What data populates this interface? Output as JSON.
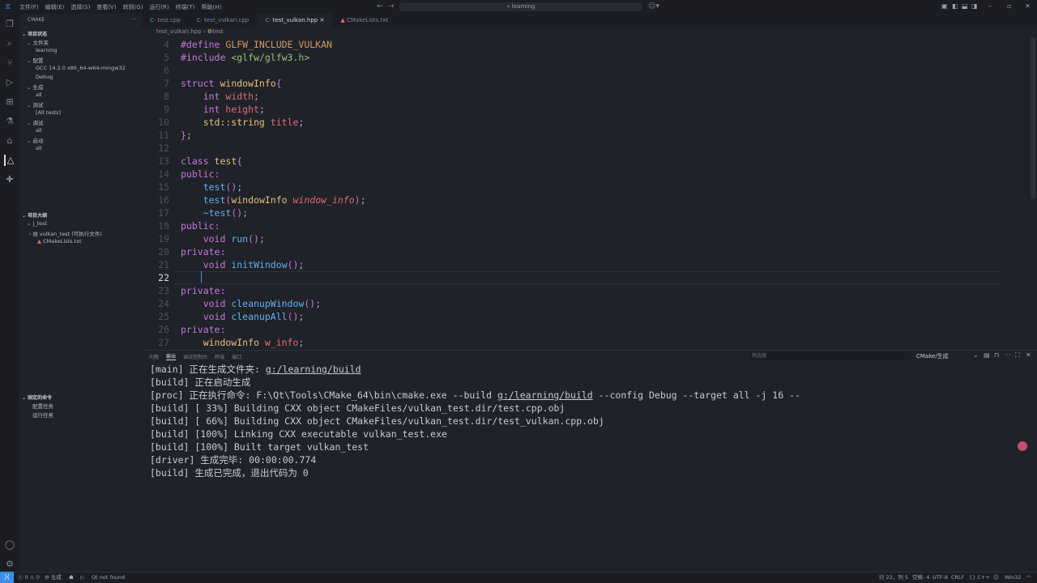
{
  "titlebar": {
    "menus": [
      "文件(F)",
      "编辑(E)",
      "选择(S)",
      "查看(V)",
      "转到(G)",
      "运行(R)",
      "终端(T)",
      "帮助(H)"
    ],
    "search": "learning"
  },
  "sidebar": {
    "title": "CMAKE",
    "project_status": "项目状态",
    "folder": "文件夹",
    "folder_value": "learning",
    "config": "配置",
    "config_kit": "GCC 14.2.0 x86_64-w64-mingw32",
    "config_type": "Debug",
    "build": "生成",
    "build_value": "all",
    "test": "测试",
    "test_value": "[All tests]",
    "debug": "调试",
    "debug_value": "all",
    "launch": "启动",
    "launch_value": "all",
    "outline": "项目大纲",
    "outline_root": "j_test",
    "outline_target": "vulkan_test (可执行文件)",
    "outline_file": "CMakeLists.txt",
    "pinned": "固定的命令",
    "pinned_items": [
      "配置任务",
      "运行任务"
    ]
  },
  "tabs": [
    {
      "label": "test.cpp"
    },
    {
      "label": "test_vulkan.cpp"
    },
    {
      "label": "test_vulkan.hpp",
      "active": true
    },
    {
      "label": "CMakeLists.txt"
    }
  ],
  "breadcrumb": [
    "test_vulkan.hpp",
    "test"
  ],
  "code": [
    {
      "n": "4",
      "t": [
        [
          "#define ",
          "kw"
        ],
        [
          "GLFW_INCLUDE_VULKAN",
          "df"
        ]
      ]
    },
    {
      "n": "5",
      "t": [
        [
          "#include ",
          "kw"
        ],
        [
          "<glfw/glfw3.h>",
          "st"
        ]
      ]
    },
    {
      "n": "6",
      "t": []
    },
    {
      "n": "7",
      "t": [
        [
          "struct ",
          "kw"
        ],
        [
          "windowInfo",
          "ty"
        ],
        [
          "{",
          "br"
        ]
      ]
    },
    {
      "n": "8",
      "t": [
        [
          "    int ",
          "kw"
        ],
        [
          "width",
          "va"
        ],
        [
          ";",
          ""
        ]
      ]
    },
    {
      "n": "9",
      "t": [
        [
          "    int ",
          "kw"
        ],
        [
          "height",
          "va"
        ],
        [
          ";",
          ""
        ]
      ]
    },
    {
      "n": "10",
      "t": [
        [
          "    std::string ",
          "ty"
        ],
        [
          "title",
          "va"
        ],
        [
          ";",
          ""
        ]
      ]
    },
    {
      "n": "11",
      "t": [
        [
          "}",
          "br"
        ],
        [
          ";",
          ""
        ]
      ]
    },
    {
      "n": "12",
      "t": []
    },
    {
      "n": "13",
      "t": [
        [
          "class ",
          "kw"
        ],
        [
          "test",
          "ty"
        ],
        [
          "{",
          "br"
        ]
      ]
    },
    {
      "n": "14",
      "t": [
        [
          "public:",
          "kw"
        ]
      ]
    },
    {
      "n": "15",
      "t": [
        [
          "    test",
          "fn"
        ],
        [
          "()",
          "br"
        ],
        [
          ";",
          ""
        ]
      ]
    },
    {
      "n": "16",
      "t": [
        [
          "    test",
          "fn"
        ],
        [
          "(",
          "br"
        ],
        [
          "windowInfo ",
          "ty"
        ],
        [
          "window_info",
          "it"
        ],
        [
          ")",
          "br"
        ],
        [
          ";",
          ""
        ]
      ]
    },
    {
      "n": "17",
      "t": [
        [
          "    ~test",
          "fn"
        ],
        [
          "()",
          "br"
        ],
        [
          ";",
          ""
        ]
      ]
    },
    {
      "n": "18",
      "t": [
        [
          "public:",
          "kw"
        ]
      ]
    },
    {
      "n": "19",
      "t": [
        [
          "    void ",
          "kw"
        ],
        [
          "run",
          "fn"
        ],
        [
          "()",
          "br"
        ],
        [
          ";",
          ""
        ]
      ]
    },
    {
      "n": "20",
      "t": [
        [
          "private:",
          "kw"
        ]
      ]
    },
    {
      "n": "21",
      "t": [
        [
          "    void ",
          "kw"
        ],
        [
          "initWindow",
          "fn"
        ],
        [
          "()",
          "br"
        ],
        [
          ";",
          ""
        ]
      ]
    },
    {
      "n": "22",
      "t": [],
      "current": true
    },
    {
      "n": "23",
      "t": [
        [
          "private:",
          "kw"
        ]
      ]
    },
    {
      "n": "24",
      "t": [
        [
          "    void ",
          "kw"
        ],
        [
          "cleanupWindow",
          "fn"
        ],
        [
          "()",
          "br"
        ],
        [
          ";",
          ""
        ]
      ]
    },
    {
      "n": "25",
      "t": [
        [
          "    void ",
          "kw"
        ],
        [
          "cleanupAll",
          "fn"
        ],
        [
          "()",
          "br"
        ],
        [
          ";",
          ""
        ]
      ]
    },
    {
      "n": "26",
      "t": [
        [
          "private:",
          "kw"
        ]
      ]
    },
    {
      "n": "27",
      "t": [
        [
          "    windowInfo ",
          "ty"
        ],
        [
          "w_info",
          "va"
        ],
        [
          ";",
          ""
        ]
      ]
    }
  ],
  "panel": {
    "tabs": [
      "问题",
      "输出",
      "调试控制台",
      "终端",
      "端口"
    ],
    "active_tab": 1,
    "filter_placeholder": "筛选器",
    "channel": "CMake/生成"
  },
  "output": [
    [
      "[main] 正在生成文件夹: ",
      "g:/learning/build",
      ""
    ],
    [
      "[build] 正在启动生成",
      "",
      ""
    ],
    [
      "[proc] 正在执行命令: F:\\Qt\\Tools\\CMake_64\\bin\\cmake.exe --build ",
      "g:/learning/build",
      " --config Debug --target all -j 16 --"
    ],
    [
      "[build] [ 33%] Building CXX object CMakeFiles/vulkan_test.dir/test.cpp.obj",
      "",
      ""
    ],
    [
      "[build] [ 66%] Building CXX object CMakeFiles/vulkan_test.dir/test_vulkan.cpp.obj",
      "",
      ""
    ],
    [
      "[build] [100%] Linking CXX executable vulkan_test.exe",
      "",
      ""
    ],
    [
      "[build] [100%] Built target vulkan_test",
      "",
      ""
    ],
    [
      "[driver] 生成完毕: 00:00:00.774",
      "",
      ""
    ],
    [
      "[build] 生成已完成，退出代码为 0",
      "",
      ""
    ]
  ],
  "status": {
    "errors": "0",
    "warnings": "0",
    "build": "生成",
    "qt": "Qt not found",
    "position": "行 22，列 5",
    "spaces": "空格: 4",
    "encoding": "UTF-8",
    "eol": "CRLF",
    "language": "C++",
    "platform": "Win32"
  },
  "colors": {
    "accent": "#3b8eea",
    "background": "#1f2228"
  }
}
